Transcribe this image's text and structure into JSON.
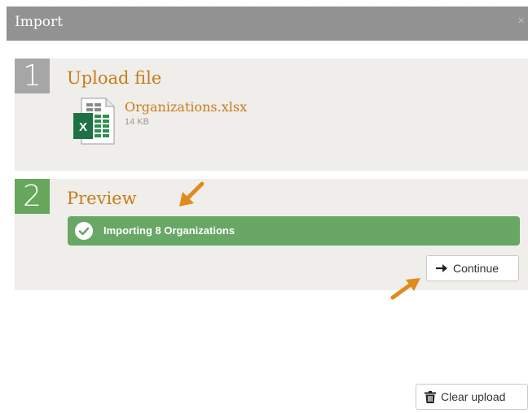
{
  "modal": {
    "title": "Import",
    "close_symbol": "×"
  },
  "steps": [
    {
      "number": "1",
      "title": "Upload file",
      "file": {
        "name": "Organizations.xlsx",
        "size": "14 KB",
        "icon": "excel-file-icon"
      }
    },
    {
      "number": "2",
      "title": "Preview",
      "status": {
        "text": "Importing 8 Organizations",
        "icon": "check-circle-icon"
      },
      "continue_label": "Continue",
      "continue_icon": "arrow-right-icon"
    }
  ],
  "footer": {
    "clear_label": "Clear upload",
    "clear_icon": "trash-icon"
  },
  "colors": {
    "header_bg": "#909090",
    "step_bg": "#f0eeea",
    "step1_number_bg": "#a6a6a6",
    "step2_number_bg": "#66a75c",
    "title_text": "#c77c1a",
    "status_bar": "#68a765",
    "annotation_arrow": "#e08a1e"
  }
}
